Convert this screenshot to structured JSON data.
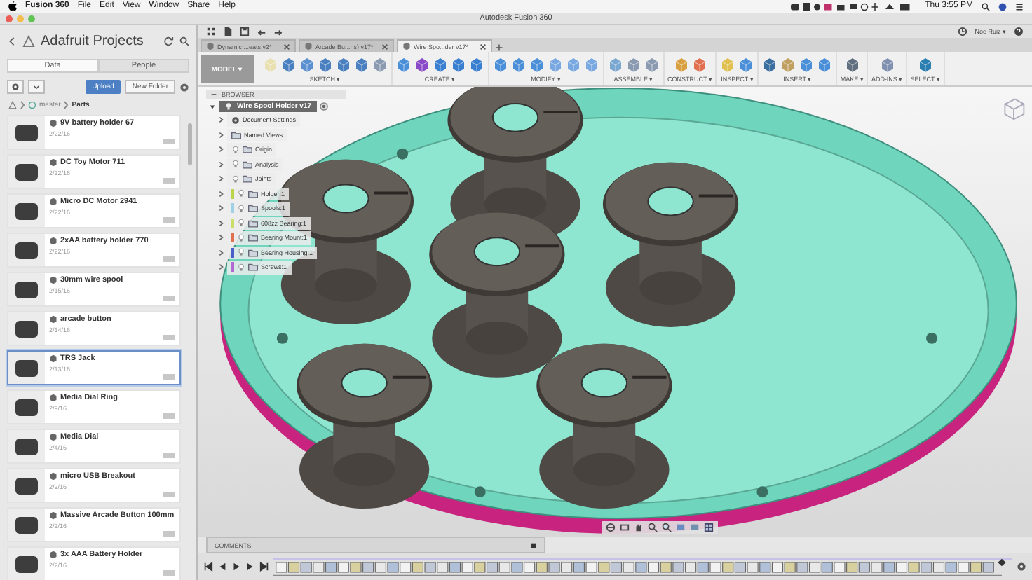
{
  "menu_bar": {
    "app": "Fusion 360",
    "items": [
      "File",
      "Edit",
      "View",
      "Window",
      "Share",
      "Help"
    ],
    "clock": "Thu 3:55 PM"
  },
  "window": {
    "title": "Autodesk Fusion 360"
  },
  "data_panel": {
    "title": "Adafruit Projects",
    "tabs": [
      {
        "label": "Data",
        "selected": true
      },
      {
        "label": "People",
        "selected": false
      }
    ],
    "upload": "Upload",
    "new_folder": "New Folder",
    "breadcrumb": [
      "master",
      "Parts"
    ],
    "items": [
      {
        "name": "9V battery holder 67",
        "date": "2/22/16",
        "selected": false
      },
      {
        "name": "DC Toy Motor 711",
        "date": "2/22/16",
        "selected": false
      },
      {
        "name": "Micro DC Motor 2941",
        "date": "2/22/16",
        "selected": false
      },
      {
        "name": "2xAA battery holder 770",
        "date": "2/22/16",
        "selected": false
      },
      {
        "name": "30mm wire spool",
        "date": "2/15/16",
        "selected": false
      },
      {
        "name": "arcade button",
        "date": "2/14/16",
        "selected": false
      },
      {
        "name": "TRS Jack",
        "date": "2/13/16",
        "selected": true
      },
      {
        "name": "Media Dial Ring",
        "date": "2/9/16",
        "selected": false
      },
      {
        "name": "Media Dial",
        "date": "2/4/16",
        "selected": false
      },
      {
        "name": "micro USB Breakout",
        "date": "2/2/16",
        "selected": false
      },
      {
        "name": "Massive Arcade Button 100mm",
        "date": "2/2/16",
        "selected": false
      },
      {
        "name": "3x AAA Battery Holder",
        "date": "2/2/16",
        "selected": false
      }
    ]
  },
  "user": "Noe Ruiz ▾",
  "doc_tabs": [
    {
      "label": "Dynamic ...eats v2*",
      "selected": false
    },
    {
      "label": "Arcade Bu...ns) v17*",
      "selected": false
    },
    {
      "label": "Wire Spo...der v17*",
      "selected": true
    }
  ],
  "workspace": "MODEL ▾",
  "tool_groups": [
    "SKETCH ▾",
    "CREATE ▾",
    "MODIFY ▾",
    "ASSEMBLE ▾",
    "CONSTRUCT ▾",
    "INSPECT ▾",
    "INSERT ▾",
    "MAKE ▾",
    "ADD-INS ▾",
    "SELECT ▾"
  ],
  "browser": {
    "title": "BROWSER",
    "root": "Wire Spool Holder v17",
    "items": [
      {
        "label": "Document Settings",
        "kind": "settings"
      },
      {
        "label": "Named Views",
        "kind": "folder"
      },
      {
        "label": "Origin",
        "kind": "folder"
      },
      {
        "label": "Analysis",
        "kind": "folder"
      },
      {
        "label": "Joints",
        "kind": "folder"
      },
      {
        "label": "Holder:1",
        "kind": "component",
        "color": "#b9d64b"
      },
      {
        "label": "Spools:1",
        "kind": "component",
        "color": "#9fd0e6"
      },
      {
        "label": "608zz Bearing:1",
        "kind": "component",
        "color": "#c8df6a"
      },
      {
        "label": "Bearing Mount:1",
        "kind": "component",
        "color": "#e0704e"
      },
      {
        "label": "Bearing Housing:1",
        "kind": "component",
        "color": "#4a5fc8"
      },
      {
        "label": "Screws:1",
        "kind": "component",
        "color": "#b06ad0"
      }
    ]
  },
  "comments": {
    "title": "COMMENTS"
  }
}
